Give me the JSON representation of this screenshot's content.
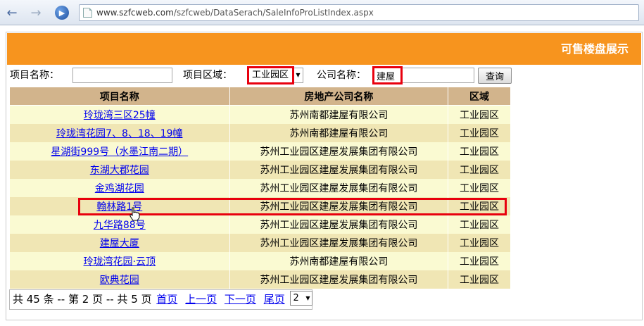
{
  "browser": {
    "url_domain": "www.szfcweb.com",
    "url_path": "/szfcweb/DataSerach/SaleInfoProListIndex.aspx",
    "back_glyph": "←",
    "forward_glyph": "→",
    "go_glyph": "▶"
  },
  "banner": {
    "title": "可售楼盘展示",
    "color": "#f7941e"
  },
  "search": {
    "project_name_label": "项目名称：",
    "project_name_value": "",
    "area_label": "项目区域：",
    "area_selected": "工业园区",
    "company_label": "公司名称：",
    "company_value": "建屋",
    "query_button": "查询"
  },
  "table": {
    "headers": [
      "项目名称",
      "房地产公司名称",
      "区域"
    ],
    "rows": [
      {
        "project": "玲珑湾三区25幢",
        "company": "苏州南都建屋有限公司",
        "area": "工业园区"
      },
      {
        "project": "玲珑湾花园7、8、18、19幢",
        "company": "苏州南都建屋有限公司",
        "area": "工业园区"
      },
      {
        "project": "星湖街999号（水墨江南二期）",
        "company": "苏州工业园区建屋发展集团有限公司",
        "area": "工业园区"
      },
      {
        "project": "东湖大郡花园",
        "company": "苏州工业园区建屋发展集团有限公司",
        "area": "工业园区"
      },
      {
        "project": "金鸡湖花园",
        "company": "苏州工业园区建屋发展集团有限公司",
        "area": "工业园区"
      },
      {
        "project": "翰林路1号",
        "company": "苏州工业园区建屋发展集团有限公司",
        "area": "工业园区"
      },
      {
        "project": "九华路88号",
        "company": "苏州工业园区建屋发展集团有限公司",
        "area": "工业园区"
      },
      {
        "project": "建屋大厦",
        "company": "苏州工业园区建屋发展集团有限公司",
        "area": "工业园区"
      },
      {
        "project": "玲珑湾花园·云顶",
        "company": "苏州南都建屋有限公司",
        "area": "工业园区"
      },
      {
        "project": "欧典花园",
        "company": "苏州工业园区建屋发展集团有限公司",
        "area": "工业园区"
      }
    ],
    "highlighted_row": 5
  },
  "pager": {
    "summary": "共 45 条 -- 第 2 页 -- 共 5 页",
    "first": "首页",
    "prev": "上一页",
    "next": "下一页",
    "last": "尾页",
    "page_selected": "2"
  },
  "colors": {
    "highlight": "#e8000e",
    "header_bg": "#d2b48c",
    "row_odd": "#fafad2",
    "row_even": "#f0e6b4"
  },
  "cursor_icon": "hand-pointer-icon"
}
